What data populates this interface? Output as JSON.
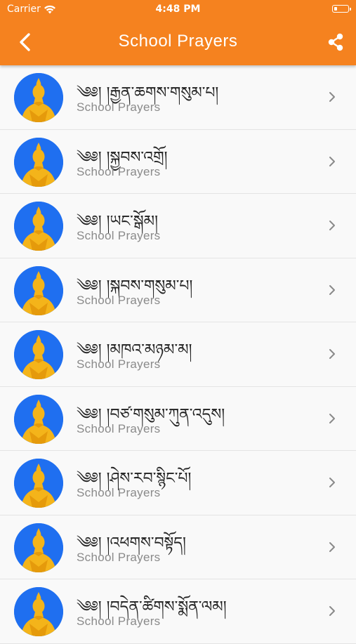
{
  "status_bar": {
    "carrier": "Carrier",
    "time": "4:48 PM"
  },
  "header": {
    "title": "School Prayers",
    "accent_color": "#f5821f"
  },
  "icons": {
    "back": "chevron-left-icon",
    "share": "share-icon",
    "row_arrow": "chevron-right-icon",
    "avatar": "buddha-avatar-icon"
  },
  "prayers": [
    {
      "title": "༄༅། །རྒྱན་ཆགས་གསུམ་པ།",
      "subtitle": "School Prayers"
    },
    {
      "title": "༄༅། །སྐྱབས་འགྲོ།",
      "subtitle": "School Prayers"
    },
    {
      "title": "༄༅། །ཡང་སྒོམ།",
      "subtitle": "School Prayers"
    },
    {
      "title": "༄༅། །སྐབས་གསུམ་པ།",
      "subtitle": "School Prayers"
    },
    {
      "title": "༄༅། །མཁའ་མཉམ་མ།",
      "subtitle": "School Prayers"
    },
    {
      "title": "༄༅། །བཙ་གསུམ་ཀུན་འདུས།",
      "subtitle": "School Prayers"
    },
    {
      "title": "༄༅། །ཤེས་རབ་སྙིང་པོ།",
      "subtitle": "School Prayers"
    },
    {
      "title": "༄༅། །འཕགས་བསྟོད།",
      "subtitle": "School Prayers"
    },
    {
      "title": "༄༅། །བདེན་ཚིགས་སྨོན་ལམ།",
      "subtitle": "School Prayers"
    }
  ]
}
